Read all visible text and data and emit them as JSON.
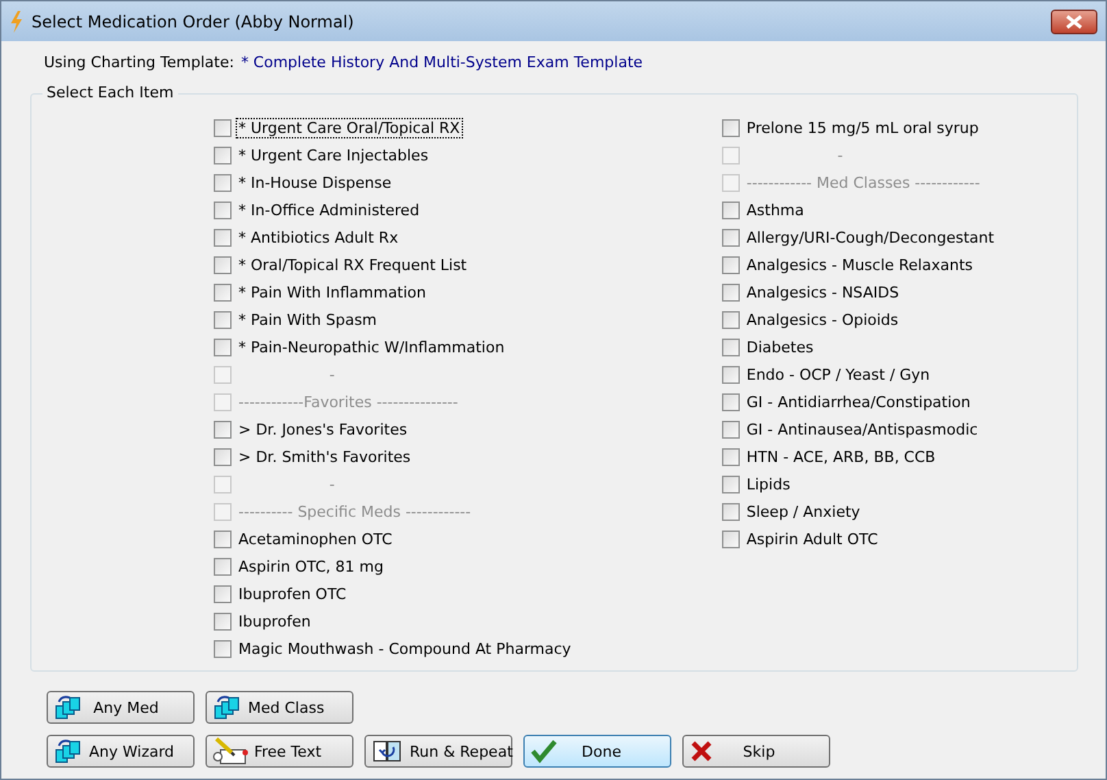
{
  "window": {
    "title": "Select Medication Order (Abby Normal)"
  },
  "template": {
    "label": "Using Charting Template:",
    "value": "* Complete History And Multi-System Exam Template"
  },
  "group": {
    "title": "Select Each Item",
    "columns": [
      [
        {
          "label": "* Urgent Care Oral/Topical RX",
          "checked": false,
          "disabled": false,
          "focused": true
        },
        {
          "label": "* Urgent Care Injectables",
          "checked": false,
          "disabled": false,
          "focused": false
        },
        {
          "label": "* In-House Dispense",
          "checked": false,
          "disabled": false,
          "focused": false
        },
        {
          "label": "* In-Office Administered",
          "checked": false,
          "disabled": false,
          "focused": false
        },
        {
          "label": "* Antibiotics Adult Rx",
          "checked": false,
          "disabled": false,
          "focused": false
        },
        {
          "label": "* Oral/Topical RX Frequent List",
          "checked": false,
          "disabled": false,
          "focused": false
        },
        {
          "label": "* Pain With Inflammation",
          "checked": false,
          "disabled": false,
          "focused": false
        },
        {
          "label": "* Pain With Spasm",
          "checked": false,
          "disabled": false,
          "focused": false
        },
        {
          "label": "* Pain-Neuropathic W/Inflammation",
          "checked": false,
          "disabled": false,
          "focused": false
        },
        {
          "label": "                   -",
          "checked": false,
          "disabled": true,
          "focused": false
        },
        {
          "label": "------------Favorites ---------------",
          "checked": false,
          "disabled": true,
          "focused": false
        },
        {
          "label": "> Dr. Jones's Favorites",
          "checked": false,
          "disabled": false,
          "focused": false
        },
        {
          "label": "> Dr. Smith's Favorites",
          "checked": false,
          "disabled": false,
          "focused": false
        },
        {
          "label": "                   -",
          "checked": false,
          "disabled": true,
          "focused": false
        },
        {
          "label": "---------- Specific Meds ------------",
          "checked": false,
          "disabled": true,
          "focused": false
        },
        {
          "label": "Acetaminophen OTC",
          "checked": false,
          "disabled": false,
          "focused": false
        },
        {
          "label": "Aspirin OTC, 81 mg",
          "checked": false,
          "disabled": false,
          "focused": false
        },
        {
          "label": "Ibuprofen OTC",
          "checked": false,
          "disabled": false,
          "focused": false
        },
        {
          "label": "Ibuprofen",
          "checked": false,
          "disabled": false,
          "focused": false
        },
        {
          "label": "Magic Mouthwash - Compound At Pharmacy",
          "checked": false,
          "disabled": false,
          "focused": false
        }
      ],
      [
        {
          "label": "Prelone 15 mg/5 mL oral syrup",
          "checked": false,
          "disabled": false,
          "focused": false
        },
        {
          "label": "                   -",
          "checked": false,
          "disabled": true,
          "focused": false
        },
        {
          "label": "------------ Med Classes ------------",
          "checked": false,
          "disabled": true,
          "focused": false
        },
        {
          "label": "Asthma",
          "checked": false,
          "disabled": false,
          "focused": false
        },
        {
          "label": "Allergy/URI-Cough/Decongestant",
          "checked": false,
          "disabled": false,
          "focused": false
        },
        {
          "label": "Analgesics - Muscle Relaxants",
          "checked": false,
          "disabled": false,
          "focused": false
        },
        {
          "label": "Analgesics - NSAIDS",
          "checked": false,
          "disabled": false,
          "focused": false
        },
        {
          "label": "Analgesics - Opioids",
          "checked": false,
          "disabled": false,
          "focused": false
        },
        {
          "label": "Diabetes",
          "checked": false,
          "disabled": false,
          "focused": false
        },
        {
          "label": "Endo - OCP / Yeast / Gyn",
          "checked": false,
          "disabled": false,
          "focused": false
        },
        {
          "label": "GI - Antidiarrhea/Constipation",
          "checked": false,
          "disabled": false,
          "focused": false
        },
        {
          "label": "GI - Antinausea/Antispasmodic",
          "checked": false,
          "disabled": false,
          "focused": false
        },
        {
          "label": "HTN - ACE, ARB, BB, CCB",
          "checked": false,
          "disabled": false,
          "focused": false
        },
        {
          "label": "Lipids",
          "checked": false,
          "disabled": false,
          "focused": false
        },
        {
          "label": "Sleep / Anxiety",
          "checked": false,
          "disabled": false,
          "focused": false
        },
        {
          "label": "Aspirin Adult OTC",
          "checked": false,
          "disabled": false,
          "focused": false
        }
      ]
    ]
  },
  "button_rows": [
    [
      {
        "label": "Any Med",
        "kind": "squares",
        "default": false
      },
      {
        "label": "Med Class",
        "kind": "squares",
        "default": false
      }
    ],
    [
      {
        "label": "Any Wizard",
        "kind": "squares",
        "default": false
      },
      {
        "label": "Free Text",
        "kind": "pencil",
        "default": false
      },
      {
        "label": "Run & Repeat",
        "kind": "repeat",
        "default": false
      },
      {
        "label": "Done",
        "kind": "check",
        "default": true
      },
      {
        "label": "Skip",
        "kind": "cross",
        "default": false
      }
    ]
  ]
}
